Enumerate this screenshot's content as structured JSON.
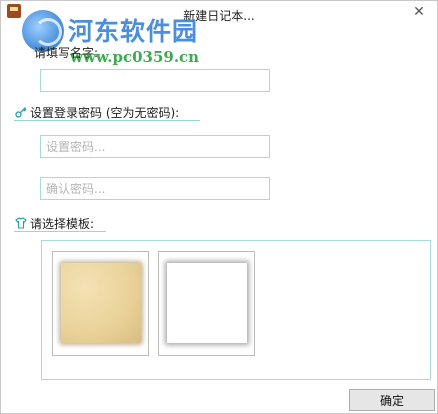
{
  "window": {
    "title": "新建日记本...",
    "close_glyph": "✕"
  },
  "watermark": {
    "site_name": "河东软件园",
    "url": "www.pc0359.cn"
  },
  "form": {
    "name_label": "请填写名字:",
    "name_value": "",
    "password_section_label": "设置登录密码 (空为无密码):",
    "password_placeholder": "设置密码...",
    "confirm_placeholder": "确认密码...",
    "template_section_label": "请选择模板:"
  },
  "templates": [
    {
      "name": "paper",
      "selected": true
    },
    {
      "name": "blank",
      "selected": false
    }
  ],
  "buttons": {
    "confirm_label": "确定"
  },
  "icons": {
    "app": "notebook-icon",
    "password": "key-icon",
    "template": "shirt-icon"
  },
  "colors": {
    "accent_border": "#a9dada",
    "label_underline": "#9ad6d6",
    "watermark_blue": "#2c7cd6",
    "watermark_green": "#27a33c"
  }
}
